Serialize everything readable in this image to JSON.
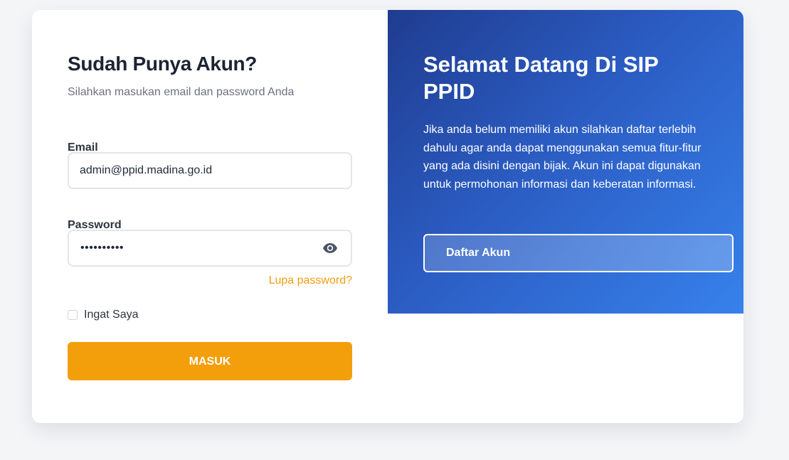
{
  "login": {
    "title": "Sudah Punya Akun?",
    "subtitle": "Silahkan masukan email dan password Anda",
    "email_label": "Email",
    "email_value": "admin@ppid.madina.go.id",
    "password_label": "Password",
    "password_value": "••••••••••",
    "password_toggle_icon": "eye-icon",
    "forgot_link": "Lupa password?",
    "remember_label": "Ingat Saya",
    "remember_checked": false,
    "submit_label": "MASUK"
  },
  "welcome": {
    "title": "Selamat Datang Di SIP PPID",
    "description": "Jika anda belum memiliki akun silahkan daftar terlebih dahulu agar anda dapat menggunakan semua fitur-fitur yang ada disini dengan bijak. Akun ini dapat digunakan untuk permohonan informasi dan keberatan informasi.",
    "register_label": "Daftar Akun"
  },
  "colors": {
    "accent_orange": "#f39f0c",
    "panel_blue_start": "#1f3c8f",
    "panel_blue_end": "#3781ec",
    "page_background": "#f4f5f7"
  }
}
